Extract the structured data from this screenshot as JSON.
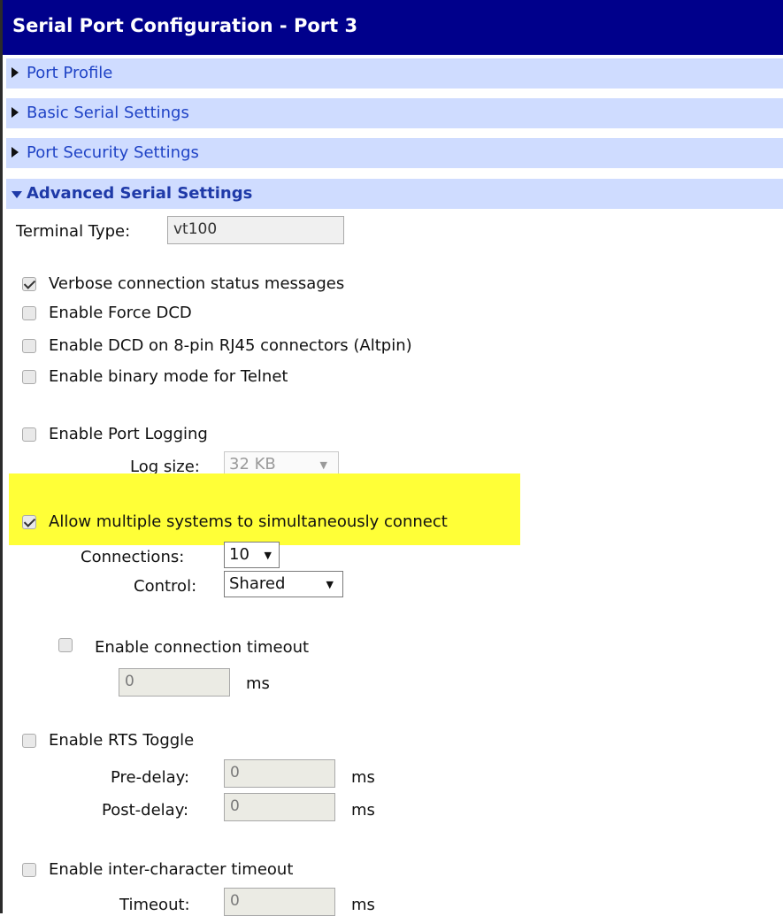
{
  "title": "Serial Port Configuration - Port 3",
  "sections": {
    "port_profile": "Port Profile",
    "basic_serial": "Basic Serial Settings",
    "port_security": "Port Security Settings",
    "advanced_serial": "Advanced Serial Settings"
  },
  "terminal": {
    "label": "Terminal Type:",
    "value": "vt100"
  },
  "options": {
    "verbose": {
      "label": "Verbose connection status messages",
      "checked": true
    },
    "force_dcd": {
      "label": "Enable Force DCD",
      "checked": false
    },
    "dcd_altpin": {
      "label": "Enable DCD on 8-pin RJ45 connectors (Altpin)",
      "checked": false
    },
    "binary_telnet": {
      "label": "Enable binary mode for Telnet",
      "checked": false
    },
    "port_logging": {
      "label": "Enable Port Logging",
      "checked": false
    },
    "multi_connect": {
      "label": "Allow multiple systems to simultaneously connect",
      "checked": true
    },
    "conn_timeout": {
      "label": "Enable connection timeout",
      "checked": false
    },
    "rts_toggle": {
      "label": "Enable RTS Toggle",
      "checked": false
    },
    "inter_char": {
      "label": "Enable inter-character timeout",
      "checked": false
    }
  },
  "log_size": {
    "label": "Log size:",
    "value": "32 KB"
  },
  "connections": {
    "label": "Connections:",
    "value": "10"
  },
  "control": {
    "label": "Control:",
    "value": "Shared"
  },
  "conn_timeout_value": {
    "value": "0",
    "unit": "ms"
  },
  "pre_delay": {
    "label": "Pre-delay:",
    "value": "0",
    "unit": "ms"
  },
  "post_delay": {
    "label": "Post-delay:",
    "value": "0",
    "unit": "ms"
  },
  "timeout": {
    "label": "Timeout:",
    "value": "0",
    "unit": "ms"
  },
  "colors": {
    "titlebar": "#00008b",
    "section_bg": "#cfdcff",
    "section_text": "#1f43c6",
    "highlight": "#ffff37"
  }
}
